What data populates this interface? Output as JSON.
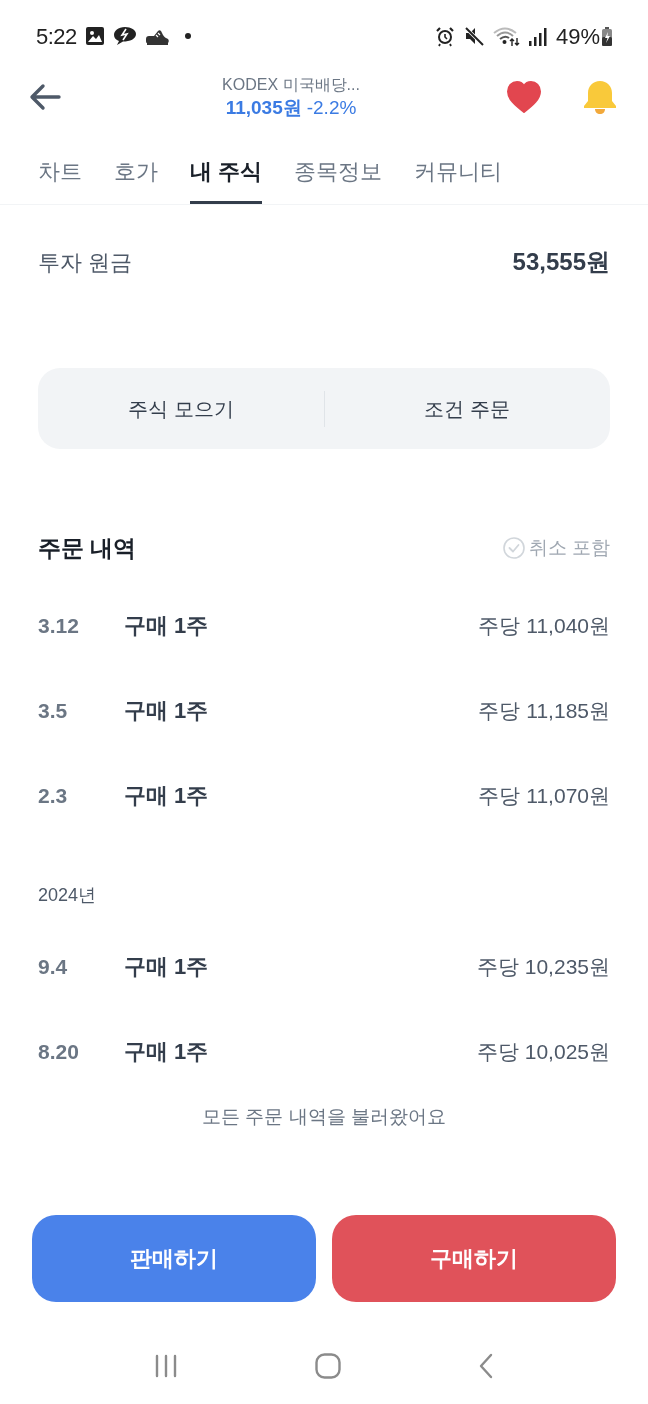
{
  "status_bar": {
    "time": "5:22",
    "battery": "49%"
  },
  "header": {
    "title": "KODEX 미국배당...",
    "price": "11,035원",
    "change": "-2.2%",
    "favorite": true
  },
  "tabs": [
    {
      "label": "차트",
      "selected": false
    },
    {
      "label": "호가",
      "selected": false
    },
    {
      "label": "내 주식",
      "selected": true
    },
    {
      "label": "종목정보",
      "selected": false
    },
    {
      "label": "커뮤니티",
      "selected": false
    }
  ],
  "principal": {
    "label": "투자 원금",
    "value": "53,555원"
  },
  "actions": [
    "주식 모으기",
    "조건 주문"
  ],
  "orders": {
    "title": "주문 내역",
    "filter": {
      "label": "취소 포함",
      "checked": false
    },
    "sections": [
      {
        "rows": [
          {
            "date": "3.12",
            "description": "구매 1주",
            "price": "주당 11,040원"
          },
          {
            "date": "3.5",
            "description": "구매 1주",
            "price": "주당 11,185원"
          },
          {
            "date": "2.3",
            "description": "구매 1주",
            "price": "주당 11,070원"
          }
        ]
      },
      {
        "heading": "2024년",
        "rows": [
          {
            "date": "9.4",
            "description": "구매 1주",
            "price": "주당 10,235원"
          },
          {
            "date": "8.20",
            "description": "구매 1주",
            "price": "주당 10,025원"
          }
        ]
      }
    ],
    "note": "모든 주문 내역을 불러왔어요"
  },
  "buttons": [
    {
      "label": "판매하기",
      "kind": "sell"
    },
    {
      "label": "구매하기",
      "kind": "buy"
    }
  ]
}
